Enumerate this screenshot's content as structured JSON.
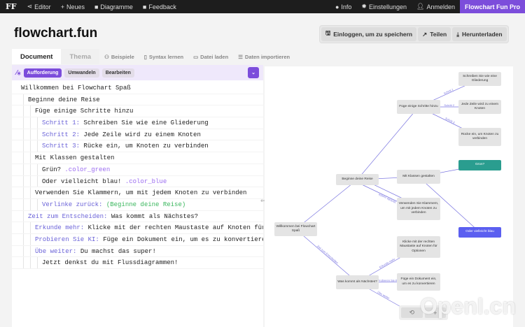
{
  "nav": {
    "logo": "FF",
    "editor": "Editor",
    "new": "Neues",
    "charts": "Diagramme",
    "feedback": "Feedback",
    "info": "Info",
    "settings": "Einstellungen",
    "login": "Anmelden",
    "pro": "Flowchart Fun Pro"
  },
  "header": {
    "title": "flowchart.fun",
    "save": "Einloggen, um zu speichern",
    "share": "Teilen",
    "download": "Herunterladen"
  },
  "tabs": {
    "document": "Document",
    "theme": "Thema",
    "examples": "Beispiele",
    "syntax": "Syntax lernen",
    "load": "Datei laden",
    "import": "Daten importieren"
  },
  "prompt": {
    "ask": "Aufforderung",
    "convert": "Umwandeln",
    "edit": "Bearbeiten"
  },
  "code": [
    {
      "i": 0,
      "k": "",
      "t": "Willkommen bei Flowchart Spaß"
    },
    {
      "i": 1,
      "k": "",
      "t": "Beginne deine Reise"
    },
    {
      "i": 2,
      "k": "",
      "t": "Füge einige Schritte hinzu"
    },
    {
      "i": 3,
      "k": "Schritt 1:",
      "t": " Schreiben Sie wie eine Gliederung"
    },
    {
      "i": 3,
      "k": "Schritt 2:",
      "t": " Jede Zeile wird zu einem Knoten"
    },
    {
      "i": 3,
      "k": "Schritt 3:",
      "t": " Rücke ein, um Knoten zu verbinden"
    },
    {
      "i": 2,
      "k": "",
      "t": "Mit Klassen gestalten"
    },
    {
      "i": 3,
      "k": "",
      "t": "Grün? ",
      "c": ".color_green"
    },
    {
      "i": 3,
      "k": "",
      "t": "Oder vielleicht blau! ",
      "c": ".color_blue"
    },
    {
      "i": 2,
      "k": "",
      "t": "Verwenden Sie Klammern, um mit jedem Knoten zu verbinden"
    },
    {
      "i": 3,
      "k": "Verlinke zurück:",
      "g": " (Beginne deine Reise)"
    },
    {
      "i": 1,
      "k": "Zeit zum Entscheiden:",
      "t": " Was kommt als Nächstes?"
    },
    {
      "i": 2,
      "k": "Erkunde mehr:",
      "t": " Klicke mit der rechten Maustaste auf Knoten für Optionen"
    },
    {
      "i": 2,
      "k": "Probieren Sie KI:",
      "t": " Füge ein Dokument ein, um es zu konvertieren"
    },
    {
      "i": 2,
      "k": "Übe weiter:",
      "t": " Du machst das super!"
    },
    {
      "i": 3,
      "k": "",
      "t": "Jetzt denkst du mit Flussdiagrammen!"
    }
  ],
  "graph": {
    "nodes": {
      "welcome": "Willkommen bei Flowchart Spaß",
      "start": "Beginne deine Reise",
      "steps": "Füge einige Schritte hinzu",
      "s1": "Schreiben Sie wie eine Gliederung",
      "s2": "Jede Zeile wird zu einem Knoten",
      "s3": "Rücke ein, um Knoten zu verbinden",
      "classes": "Mit Klassen gestalten",
      "green": "Grün?",
      "blue": "Oder vielleicht blau",
      "brackets": "Verwenden Sie Klammern, um mit jedem Knoten zu verbinden",
      "next": "Was kommt als Nächstes?",
      "explore": "Klicke mit der rechten Maustaste auf Knoten für Optionen",
      "ai": "Füge ein Dokument ein, um es zu konvertieren"
    },
    "edge_labels": {
      "s1": "Schritt 1",
      "s2": "Schritt 2",
      "s3": "Schritt 3",
      "back": "Verlinke zurück",
      "decide": "Zeit zum Entscheiden",
      "explore": "Erkunde mehr",
      "ai": "Probieren Sie KI",
      "keep": "Übe weiter"
    },
    "colors": {
      "green": "#2a9d8f",
      "blue": "#5b5ff0",
      "edge": "#7a75e0"
    }
  },
  "watermark": "OpenI.cn"
}
